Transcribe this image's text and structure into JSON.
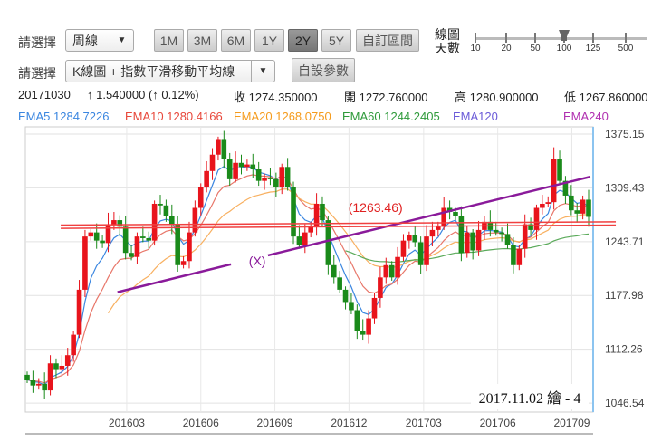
{
  "toolbar": {
    "select_label_1": "請選擇",
    "period_value": "周線",
    "ranges": [
      {
        "label": "1M",
        "active": false
      },
      {
        "label": "3M",
        "active": false
      },
      {
        "label": "6M",
        "active": false
      },
      {
        "label": "1Y",
        "active": false
      },
      {
        "label": "2Y",
        "active": true
      },
      {
        "label": "5Y",
        "active": false
      }
    ],
    "custom_range": "自訂區間",
    "days_label_1": "線圖",
    "days_label_2": "天數",
    "days_ticks": [
      "10",
      "20",
      "50",
      "100",
      "125",
      "500"
    ],
    "days_selected": "100",
    "select_label_2": "請選擇",
    "chart_type_value": "K線圖 + 指數平滑移動平均線",
    "params_button": "自設參數"
  },
  "quote": {
    "date": "20171030",
    "change": "↑ 1.540000 (↑ 0.12%)",
    "close": "收 1274.350000",
    "open": "開 1272.760000",
    "high": "高 1280.900000",
    "low": "低 1267.860000"
  },
  "legend": [
    {
      "text": "EMA5 1284.7226",
      "color": "#3a86e0"
    },
    {
      "text": "EMA10 1280.4166",
      "color": "#e8473a"
    },
    {
      "text": "EMA20 1268.0750",
      "color": "#f59b1c"
    },
    {
      "text": "EMA60 1244.2405",
      "color": "#2e9a3a"
    },
    {
      "text": "EMA120",
      "color": "#6a5ad8"
    },
    {
      "text": "EMA240",
      "color": "#b02fb0"
    }
  ],
  "watermark": "2017.11.02 繪 - 4",
  "chart_data": {
    "type": "candlestick",
    "yticks": [
      1375.15,
      1309.43,
      1243.71,
      1177.98,
      1112.26,
      1046.54
    ],
    "ylim": [
      1040,
      1385
    ],
    "xticks": [
      {
        "label": "201603",
        "index": 17.2
      },
      {
        "label": "201606",
        "index": 30
      },
      {
        "label": "201609",
        "index": 42.8
      },
      {
        "label": "201612",
        "index": 55.6
      },
      {
        "label": "201703",
        "index": 68.5
      },
      {
        "label": "201706",
        "index": 81.3
      },
      {
        "label": "201709",
        "index": 94.1
      }
    ],
    "close": [
      1075,
      1068,
      1070,
      1062,
      1095,
      1088,
      1092,
      1105,
      1130,
      1185,
      1250,
      1255,
      1245,
      1242,
      1265,
      1270,
      1262,
      1230,
      1225,
      1250,
      1248,
      1245,
      1290,
      1288,
      1275,
      1265,
      1215,
      1220,
      1255,
      1285,
      1310,
      1330,
      1350,
      1368,
      1345,
      1320,
      1340,
      1335,
      1338,
      1332,
      1318,
      1322,
      1320,
      1310,
      1335,
      1310,
      1250,
      1240,
      1255,
      1262,
      1290,
      1270,
      1215,
      1200,
      1185,
      1170,
      1160,
      1135,
      1130,
      1150,
      1175,
      1200,
      1215,
      1200,
      1225,
      1245,
      1252,
      1243,
      1215,
      1250,
      1258,
      1262,
      1285,
      1280,
      1275,
      1230,
      1255,
      1233,
      1258,
      1268,
      1258,
      1255,
      1253,
      1240,
      1215,
      1235,
      1265,
      1258,
      1285,
      1290,
      1292,
      1345,
      1318,
      1300,
      1282,
      1278,
      1295,
      1274
    ],
    "up_color": "#e8141c",
    "down_color": "#1a8a1a",
    "ema": [
      {
        "name": "EMA5",
        "period": 5,
        "start": 0,
        "color": "#3a86e0"
      },
      {
        "name": "EMA10",
        "period": 10,
        "start": 0,
        "color": "#e8776a"
      },
      {
        "name": "EMA20",
        "period": 20,
        "start": 14,
        "color": "#f8b060"
      },
      {
        "name": "EMA60",
        "period": 60,
        "start": 55,
        "color": "#5aaa5a"
      }
    ],
    "annotations": {
      "trendlines": [
        {
          "from": [
            15.6,
            1182
          ],
          "to": [
            35.2,
            1216
          ],
          "color": "#8a1a9a"
        },
        {
          "from": [
            41.6,
            1227
          ],
          "to": [
            97.3,
            1323
          ],
          "color": "#8a1a9a"
        },
        {
          "from": [
            5.8,
            1264
          ],
          "to": [
            101.7,
            1268
          ],
          "color": "#f04040"
        },
        {
          "from": [
            5.8,
            1260
          ],
          "to": [
            101.7,
            1264
          ],
          "color": "#f04040"
        }
      ],
      "labels": [
        {
          "text": "(X)",
          "at": [
            38.3,
            1215
          ],
          "color": "#8a1a9a"
        },
        {
          "text": "(1263.46)",
          "at": [
            55.5,
            1280
          ],
          "color": "#e02020"
        }
      ]
    }
  }
}
